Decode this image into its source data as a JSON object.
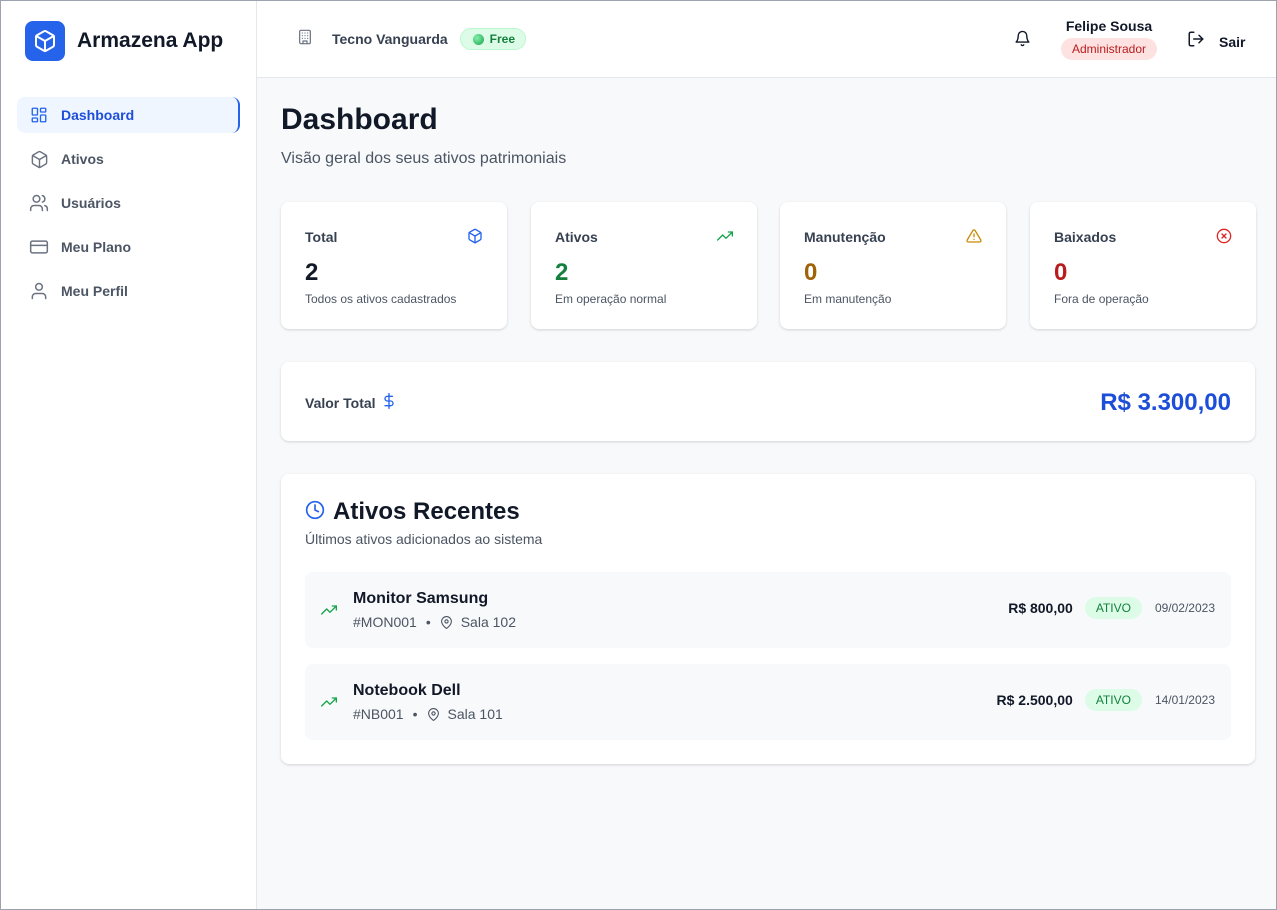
{
  "app": {
    "name": "Armazena App"
  },
  "colors": {
    "primary": "#2563eb",
    "success": "#15803d",
    "warning": "#a16207",
    "danger": "#b91c1c"
  },
  "sidebar": {
    "items": [
      {
        "label": "Dashboard",
        "icon": "dashboard-icon",
        "active": true
      },
      {
        "label": "Ativos",
        "icon": "box-icon",
        "active": false
      },
      {
        "label": "Usuários",
        "icon": "users-icon",
        "active": false
      },
      {
        "label": "Meu Plano",
        "icon": "credit-card-icon",
        "active": false
      },
      {
        "label": "Meu Perfil",
        "icon": "user-icon",
        "active": false
      }
    ]
  },
  "header": {
    "company": "Tecno Vanguarda",
    "plan": "Free",
    "user": {
      "name": "Felipe Sousa",
      "role": "Administrador"
    },
    "logout_label": "Sair"
  },
  "page": {
    "title": "Dashboard",
    "subtitle": "Visão geral dos seus ativos patrimoniais"
  },
  "stats": [
    {
      "label": "Total",
      "value": "2",
      "desc": "Todos os ativos cadastrados",
      "icon": "box-icon",
      "color": "#111827"
    },
    {
      "label": "Ativos",
      "value": "2",
      "desc": "Em operação normal",
      "icon": "trending-up-icon",
      "color": "#15803d"
    },
    {
      "label": "Manutenção",
      "value": "0",
      "desc": "Em manutenção",
      "icon": "warning-icon",
      "color": "#a16207"
    },
    {
      "label": "Baixados",
      "value": "0",
      "desc": "Fora de operação",
      "icon": "x-circle-icon",
      "color": "#b91c1c"
    }
  ],
  "total_value": {
    "label": "Valor Total",
    "amount": "R$ 3.300,00",
    "icon": "dollar-icon"
  },
  "recent": {
    "title": "Ativos Recentes",
    "subtitle": "Últimos ativos adicionados ao sistema",
    "items": [
      {
        "name": "Monitor Samsung",
        "code": "#MON001",
        "location": "Sala 102",
        "value": "R$ 800,00",
        "status": "ATIVO",
        "date": "09/02/2023"
      },
      {
        "name": "Notebook Dell",
        "code": "#NB001",
        "location": "Sala 101",
        "value": "R$ 2.500,00",
        "status": "ATIVO",
        "date": "14/01/2023"
      }
    ]
  }
}
